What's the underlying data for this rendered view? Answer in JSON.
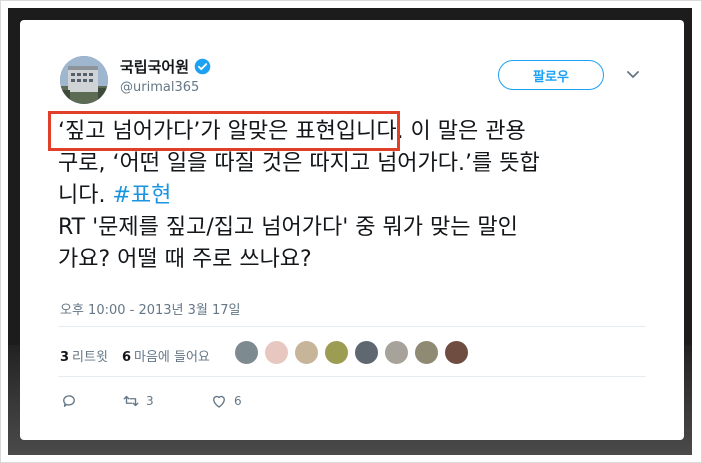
{
  "account": {
    "display_name": "국립국어원",
    "handle": "@urimal365",
    "verified": true
  },
  "follow_button": {
    "label": "팔로우"
  },
  "tweet": {
    "lines": [
      "‘짚고 넘어가다’가 알맞은 표현입니다. 이 말은 관용",
      "구로, ‘어떤 일을 따질 것은 따지고 넘어가다.’를 뜻합",
      "니다. "
    ],
    "hashtag": "#표현",
    "quoted_lines": [
      "RT '문제를 짚고/집고 넘어가다' 중 뭐가 맞는 말인",
      "가요? 어떨 때 주로 쓰나요?"
    ]
  },
  "timestamp": "오후 10:00 - 2013년 3월 17일",
  "stats": {
    "retweets_count": "3",
    "retweets_label": "리트윗",
    "likes_count": "6",
    "likes_label": "마음에 들어요"
  },
  "liker_avatar_colors": [
    "#7d8a90",
    "#e7c7c0",
    "#c7b59a",
    "#9c9d52",
    "#5f6770",
    "#a7a39b",
    "#8e8a74",
    "#6f4d41"
  ],
  "actions": {
    "reply_icon": "reply-icon",
    "retweet_count": "3",
    "like_count": "6"
  },
  "colors": {
    "accent": "#1da1f2",
    "hashtag": "#1b95e0",
    "highlight_border": "#e0402a",
    "text": "#14171a",
    "muted": "#657786"
  }
}
